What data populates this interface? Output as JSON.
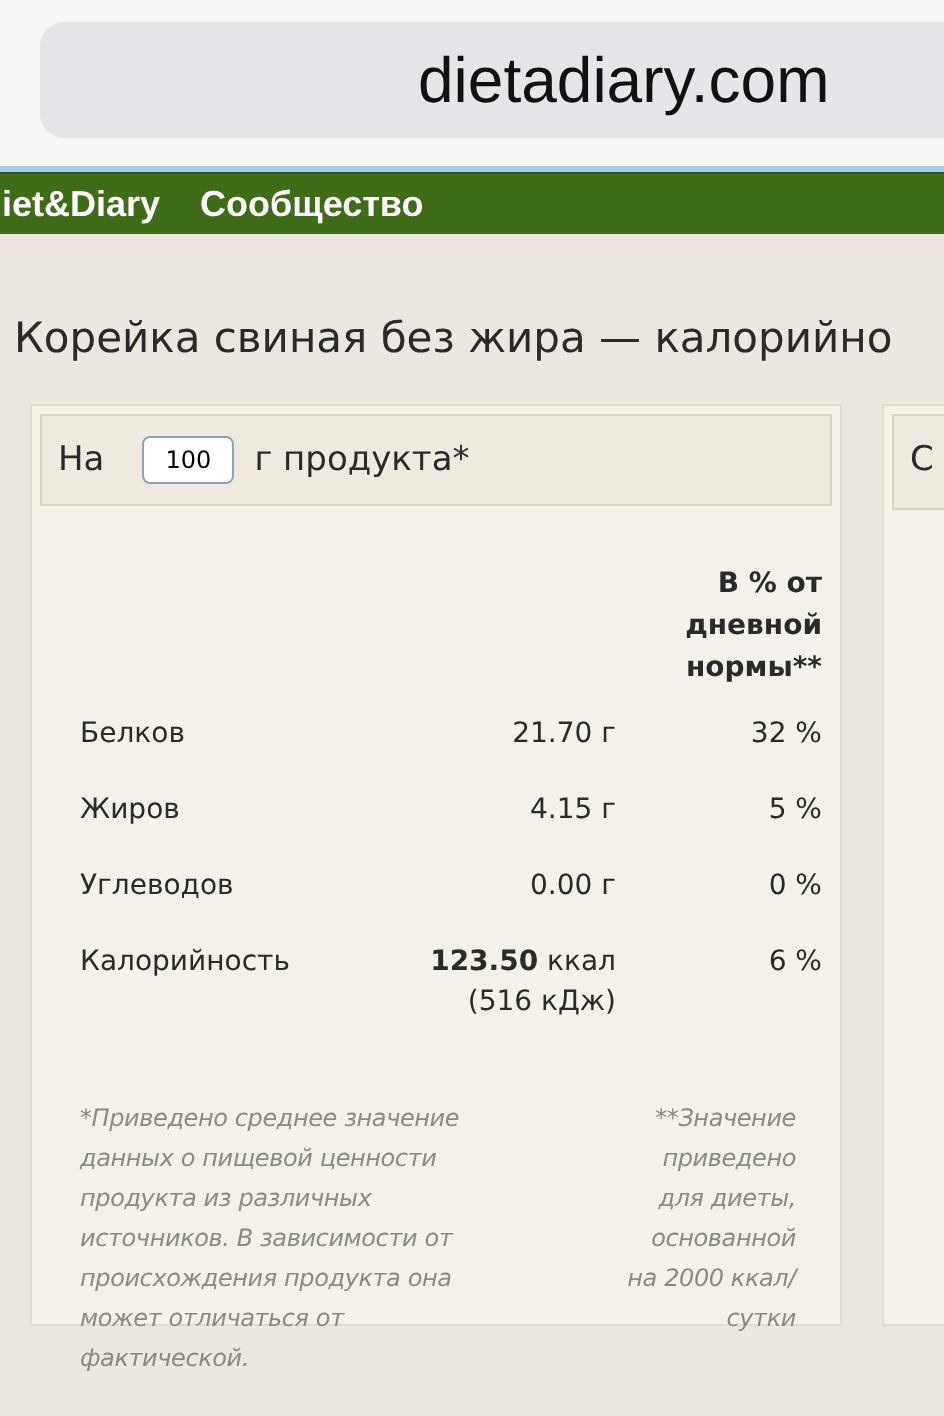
{
  "browser": {
    "address": "dietadiary.com"
  },
  "nav": {
    "items": [
      "iet&Diary",
      "Сообщество"
    ]
  },
  "title": "Корейка свиная без жира — калорийно",
  "card": {
    "prefix": "На",
    "amount": "100",
    "suffix": "г продукта*",
    "percent_header": "В % от дневной нормы**",
    "rows": [
      {
        "name": "Белков",
        "value": "21.70 г",
        "percent": "32 %"
      },
      {
        "name": "Жиров",
        "value": "4.15 г",
        "percent": "5 %"
      },
      {
        "name": "Углеводов",
        "value": "0.00 г",
        "percent": "0 %"
      },
      {
        "name": "Калорийность",
        "value": "**123.50** ккал",
        "value_note": "(516 кДж)",
        "percent": "6 %"
      }
    ],
    "note_left": "*Приведено среднее значение данных о пищевой ценности продукта из различных источников. В зависимости от происхождения продукта она может отличаться от фактической.",
    "note_right": "**Значение приведено для диеты, основанной на 2000 ккал/сутки"
  },
  "side_card": {
    "header": "С"
  }
}
